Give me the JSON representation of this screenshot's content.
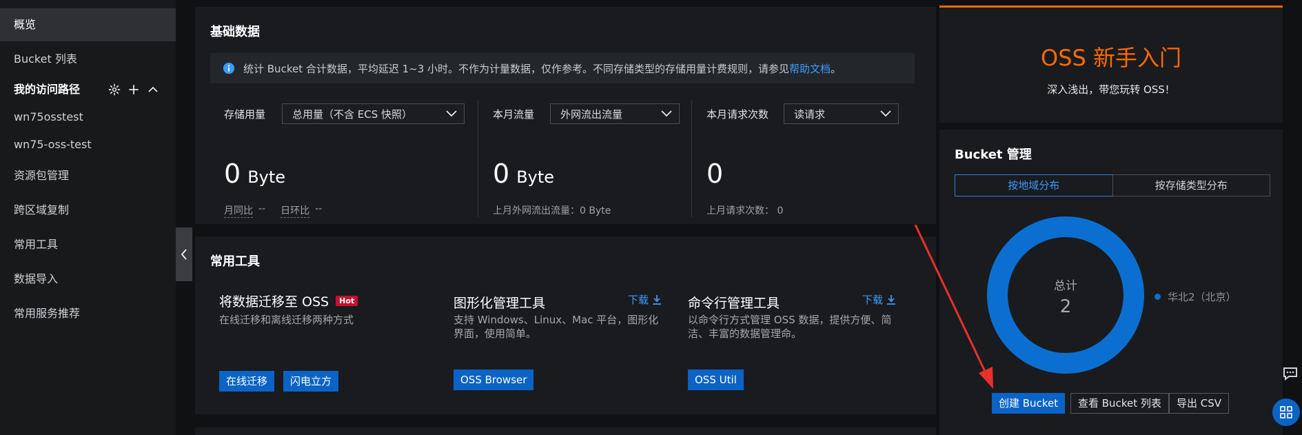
{
  "sidebar": {
    "items": [
      {
        "label": "概览",
        "active": true
      },
      {
        "label": "Bucket 列表"
      },
      {
        "label": "我的访问路径",
        "section": true
      },
      {
        "label": "wn75osstest"
      },
      {
        "label": "wn75-oss-test"
      },
      {
        "label": "资源包管理"
      },
      {
        "label": "跨区域复制"
      },
      {
        "label": "常用工具"
      },
      {
        "label": "数据导入"
      },
      {
        "label": "常用服务推荐"
      }
    ]
  },
  "basic": {
    "title": "基础数据",
    "info_text": "统计 Bucket 合计数据，平均延迟 1~3 小时。不作为计量数据，仅作参考。不同存储类型的存储用量计费规则，请参见",
    "info_link": "帮助文档",
    "info_suffix": "。",
    "storage": {
      "label": "存储用量",
      "select": "总用量（不含 ECS 快照）",
      "value": "0",
      "unit": "Byte",
      "yoy_label": "月同比",
      "yoy_value": "--",
      "mom_label": "日环比",
      "mom_value": "--"
    },
    "traffic": {
      "label": "本月流量",
      "select": "外网流出流量",
      "value": "0",
      "unit": "Byte",
      "last_month": "上月外网流出流量：0 Byte"
    },
    "requests": {
      "label": "本月请求次数",
      "select": "读请求",
      "value": "0",
      "last_month": "上月请求次数：  0"
    }
  },
  "tools": {
    "title": "常用工具",
    "migrate": {
      "title": "将数据迁移至 OSS",
      "badge": "Hot",
      "desc": "在线迁移和离线迁移两种方式",
      "btn1": "在线迁移",
      "btn2": "闪电立方"
    },
    "gui": {
      "title": "图形化管理工具",
      "download": "下载",
      "desc": "支持 Windows、Linux、Mac 平台，图形化界面，使用简单。",
      "btn": "OSS Browser"
    },
    "cli": {
      "title": "命令行管理工具",
      "download": "下载",
      "desc": "以命令行方式管理 OSS 数据，提供方便、简洁、丰富的数据管理命。",
      "btn": "OSS Util"
    }
  },
  "intro": {
    "title": "OSS 新手入门",
    "subtitle": "深入浅出，带您玩转 OSS！"
  },
  "bucket_mgmt": {
    "title": "Bucket 管理",
    "tabs": [
      "按地域分布",
      "按存储类型分布"
    ],
    "active_tab": 0,
    "total_label": "总计",
    "total_value": "2",
    "legend": [
      {
        "label": "华北2（北京）",
        "color": "#0b6fd1"
      }
    ],
    "buttons": {
      "create": "创建 Bucket",
      "view_list": "查看 Bucket 列表",
      "export": "导出 CSV"
    }
  },
  "colors": {
    "accent_orange": "#ff6a00",
    "primary_blue": "#0b63c5",
    "link_blue": "#3b9cff",
    "donut_blue": "#0b6fd1",
    "annotation_red": "#e8312b"
  }
}
